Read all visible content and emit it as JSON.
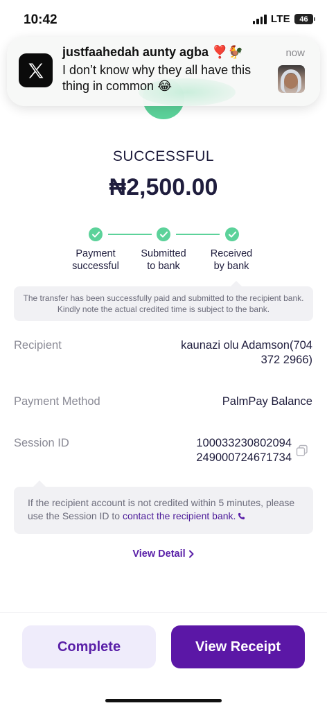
{
  "status_bar": {
    "time": "10:42",
    "network": "LTE",
    "battery": "46"
  },
  "notification": {
    "app_icon": "x-app-icon",
    "title": "justfaahedah aunty agba",
    "title_emoji": "❣️🐓",
    "body": "I don’t know why they all have this thing in common 😂",
    "time": "now"
  },
  "transaction": {
    "status": "SUCCESSFUL",
    "amount": "₦2,500.00",
    "steps": [
      {
        "label_line1": "Payment",
        "label_line2": "successful"
      },
      {
        "label_line1": "Submitted",
        "label_line2": "to bank"
      },
      {
        "label_line1": "Received",
        "label_line2": "by bank"
      }
    ],
    "info_note": "The transfer has been successfully paid and submitted to the recipient bank. Kindly note the actual credited time is subject to the bank.",
    "accent_color": "#5cd29a"
  },
  "details": {
    "recipient_label": "Recipient",
    "recipient_line1": "kaunazi olu Adamson(704",
    "recipient_line2": "372 2966)",
    "method_label": "Payment Method",
    "method_value": "PalmPay Balance",
    "session_label": "Session ID",
    "session_line1": "100033230802094",
    "session_line2": "249000724671734"
  },
  "session_note": {
    "text_before": "If the recipient account is not credited within 5 minutes, please use the Session ID to",
    "link": "contact the recipient bank."
  },
  "view_detail": "View Detail",
  "buttons": {
    "complete": "Complete",
    "view_receipt": "View Receipt"
  },
  "brand_color": "#5b17a6"
}
